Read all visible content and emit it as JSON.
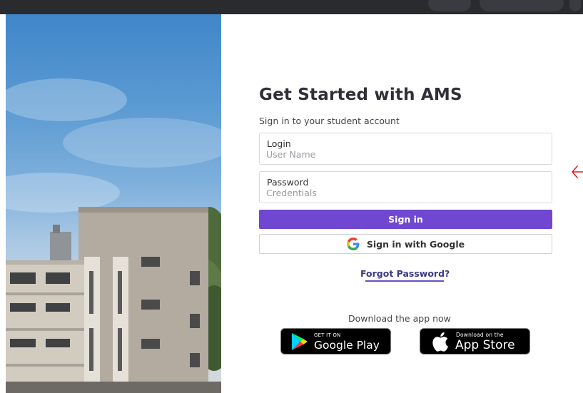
{
  "form": {
    "title": "Get Started with AMS",
    "subtitle": "Sign in to your student account",
    "login_label": "Login",
    "login_placeholder": "User Name",
    "password_label": "Password",
    "password_placeholder": "Credentials",
    "signin_label": "Sign in",
    "google_label": "Sign in with Google",
    "forgot_label": "Forgot Password?"
  },
  "download": {
    "heading": "Download the app now",
    "google_play": {
      "small": "GET IT ON",
      "big": "Google Play"
    },
    "app_store": {
      "small": "Download on the",
      "big": "App Store"
    }
  },
  "colors": {
    "accent": "#7047d0",
    "annotation": "#e02020"
  },
  "icons": {
    "google": "google-g-icon",
    "play": "google-play-icon",
    "apple": "apple-icon",
    "annotation": "red-arrow-icon"
  }
}
